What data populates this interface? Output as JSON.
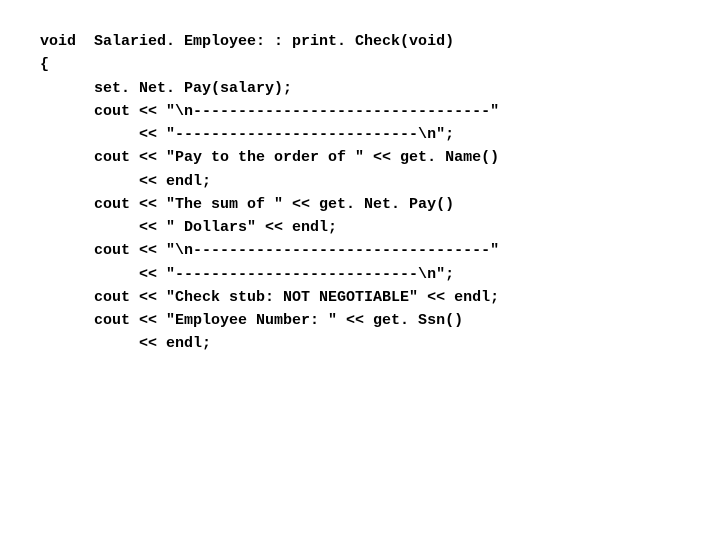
{
  "lines": [
    "void  Salaried. Employee: : print. Check(void)",
    "{",
    "      set. Net. Pay(salary);",
    "",
    "      cout << \"\\n---------------------------------\"",
    "           << \"---------------------------\\n\";",
    "      cout << \"Pay to the order of \" << get. Name()",
    "           << endl;",
    "      cout << \"The sum of \" << get. Net. Pay()",
    "           << \" Dollars\" << endl;",
    "      cout << \"\\n---------------------------------\"",
    "           << \"---------------------------\\n\";",
    "      cout << \"Check stub: NOT NEGOTIABLE\" << endl;",
    "      cout << \"Employee Number: \" << get. Ssn()",
    "           << endl;"
  ]
}
